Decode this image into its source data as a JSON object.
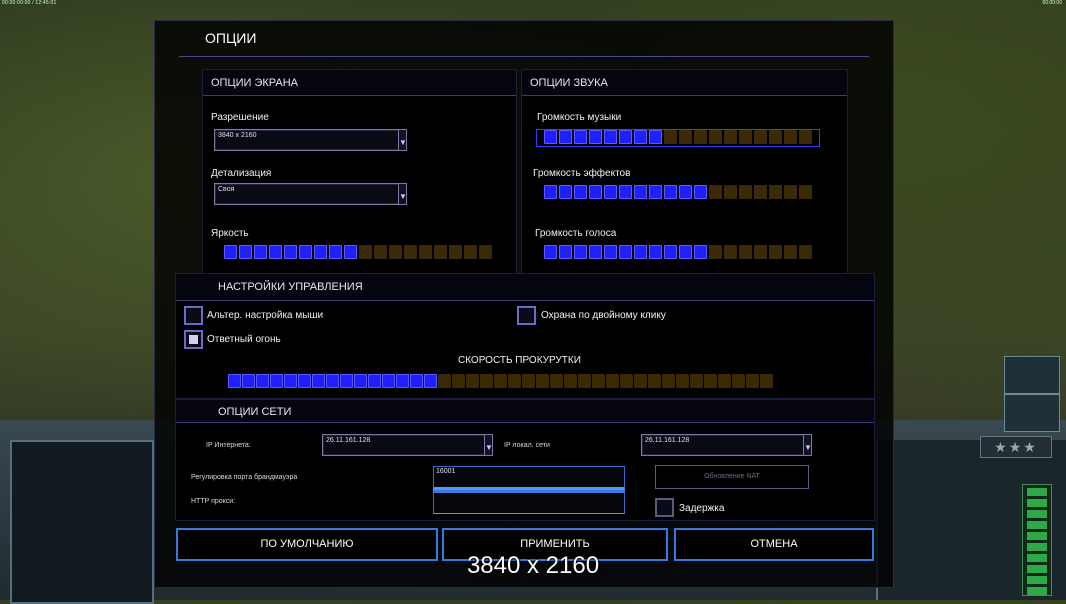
{
  "topbar": {
    "left": "00:00:00:00  / 12:45:01",
    "right": "00:00:00"
  },
  "hud": {
    "rank": "★★★"
  },
  "dialog": {
    "title": "ОПЦИИ"
  },
  "screen": {
    "header": "ОПЦИИ ЭКРАНА",
    "resolution_label": "Разрешение",
    "resolution_value": "3840 x 2160",
    "detail_label": "Детализация",
    "detail_value": "Своя",
    "brightness_label": "Яркость",
    "brightness_level": 0.5
  },
  "sound": {
    "header": "ОПЦИИ ЗВУКА",
    "music_label": "Громкость музыки",
    "music_level": 0.44,
    "effects_label": "Громкость эффектов",
    "effects_level": 0.6,
    "voice_label": "Громкость голоса",
    "voice_level": 0.6
  },
  "controls": {
    "header": "НАСТРОЙКИ УПРАВЛЕНИЯ",
    "alt_mouse_label": "Альтер. настройка мыши",
    "alt_mouse_checked": false,
    "double_click_guard_label": "Охрана по двойному клику",
    "double_click_guard_checked": false,
    "return_fire_label": "Ответный огонь",
    "return_fire_checked": true,
    "scroll_speed_label": "СКОРОСТЬ ПРОКУРУТКИ",
    "scroll_speed_level": 0.38
  },
  "network": {
    "header": "ОПЦИИ СЕТИ",
    "internet_ip_label": "IP Интернета:",
    "internet_ip_value": "26.11.161.128",
    "local_ip_label": "IP локал. сети",
    "local_ip_value": "26.11.161.128",
    "firewall_port_label": "Регулировка порта брандмауэра",
    "firewall_port_value": "16001",
    "http_proxy_label": "HTTP прокси:",
    "http_proxy_value": "",
    "nat_button": "Обновление NAT",
    "delay_label": "Задержка",
    "delay_checked": false
  },
  "buttons": {
    "defaults": "ПО УМОЛЧАНИЮ",
    "apply": "ПРИМЕНИТЬ",
    "cancel": "ОТМЕНА"
  },
  "overlay": {
    "resolution_caption": "3840 x 2160"
  }
}
